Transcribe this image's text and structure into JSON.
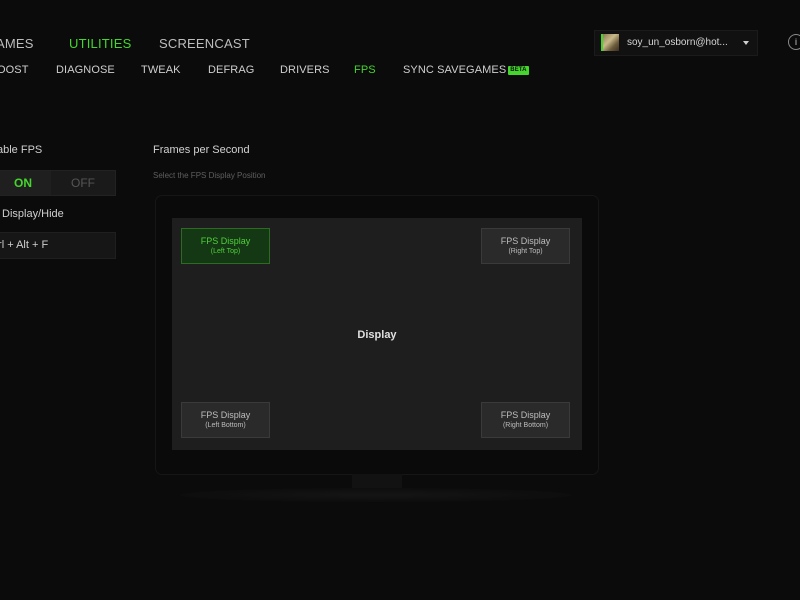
{
  "topnav": {
    "items": [
      {
        "label": "AMES",
        "active": false
      },
      {
        "label": "UTILITIES",
        "active": true
      },
      {
        "label": "SCREENCAST",
        "active": false
      }
    ]
  },
  "subnav": {
    "items": [
      {
        "label": "OOST",
        "active": false
      },
      {
        "label": "DIAGNOSE",
        "active": false
      },
      {
        "label": "TWEAK",
        "active": false
      },
      {
        "label": "DEFRAG",
        "active": false
      },
      {
        "label": "DRIVERS",
        "active": false
      },
      {
        "label": "FPS",
        "active": true
      },
      {
        "label": "SYNC SAVEGAMES",
        "active": false,
        "badge": "BETA"
      }
    ]
  },
  "account": {
    "email": "soy_un_osborn@hot...",
    "avatar_icon": "user-avatar-image",
    "caret_icon": "caret-down-icon"
  },
  "help_icon_glyph": "i",
  "left_panel": {
    "enable_label": "able FPS",
    "toggle": {
      "on_label": "ON",
      "off_label": "OFF",
      "value": "ON"
    },
    "display_hide_label": "Display/Hide",
    "hotkey_value": "trl + Alt + F"
  },
  "main": {
    "title": "Frames per Second",
    "subtitle": "Select the FPS Display Position",
    "screen_label": "Display",
    "positions": {
      "left_top": {
        "line1": "FPS Display",
        "line2": "(Left Top)",
        "selected": true
      },
      "right_top": {
        "line1": "FPS Display",
        "line2": "(Right Top)",
        "selected": false
      },
      "left_bottom": {
        "line1": "FPS Display",
        "line2": "(Left Bottom)",
        "selected": false
      },
      "right_bottom": {
        "line1": "FPS Display",
        "line2": "(Right Bottom)",
        "selected": false
      }
    }
  },
  "colors": {
    "accent": "#44d62c",
    "background": "#0b0b0b",
    "screen": "#1e1e1e",
    "selected_bg": "#143814"
  }
}
